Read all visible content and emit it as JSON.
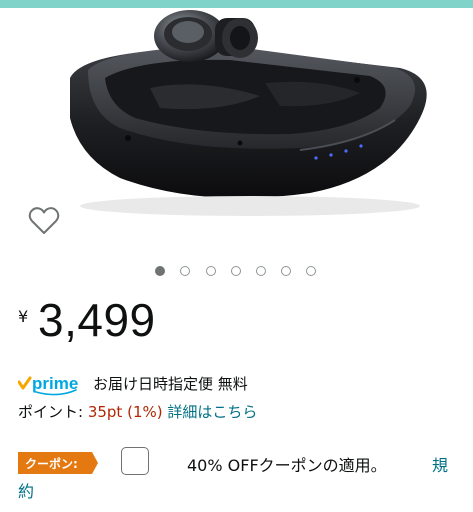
{
  "product": {
    "image_desc": "black-earbuds-charging-case-image",
    "heart_icon": "heart-outline-icon",
    "carousel": {
      "total": 7,
      "active_index": 0
    }
  },
  "price": {
    "currency": "¥",
    "value": "3,499"
  },
  "delivery": {
    "prime_label": "prime",
    "text": "お届け日時指定便 無料"
  },
  "points": {
    "label": "ポイント: ",
    "amount": "35pt",
    "percent": "(1%)",
    "link": "詳細はこちら"
  },
  "coupon": {
    "badge": "クーポン:",
    "text": "40% OFFクーポンの適用。",
    "terms_link_part1": "規",
    "terms_link_part2": "約"
  },
  "colors": {
    "price_red": "#b12704",
    "link": "#007185",
    "coupon_orange": "#e47911",
    "prime_blue": "#00a8e1",
    "prime_check": "#f7a600"
  }
}
